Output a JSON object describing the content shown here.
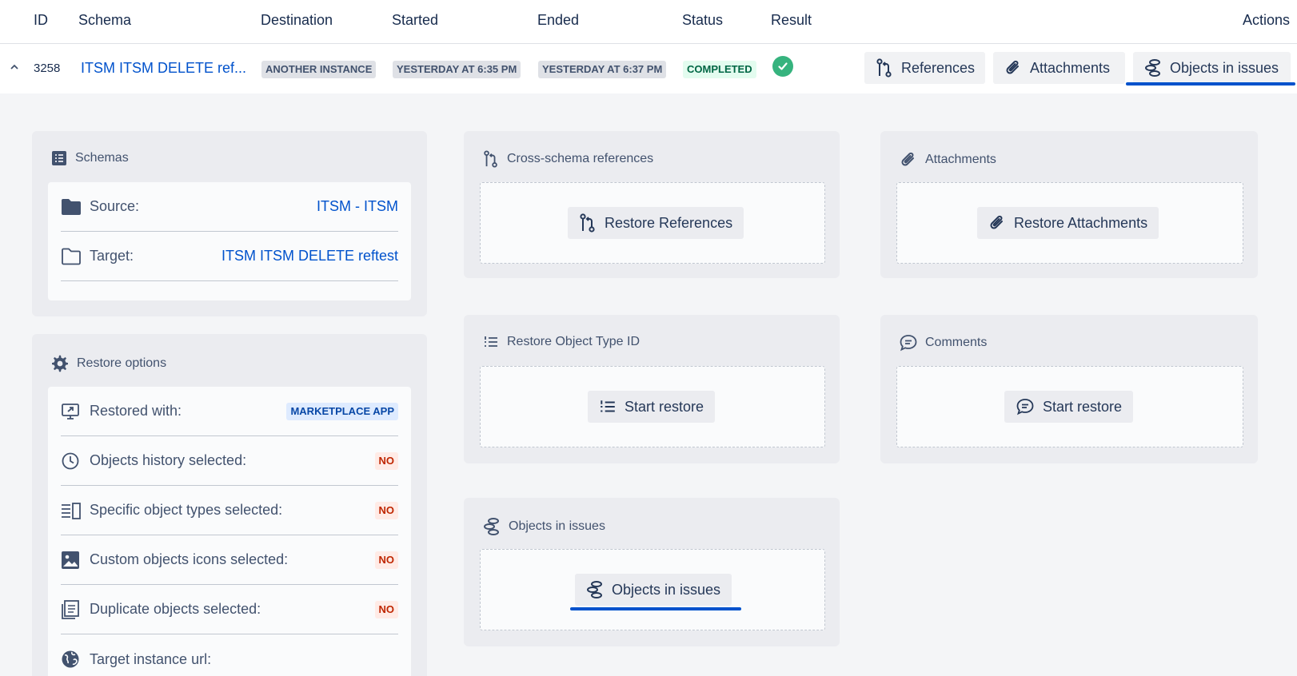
{
  "table": {
    "headers": {
      "id": "ID",
      "schema": "Schema",
      "destination": "Destination",
      "started": "Started",
      "ended": "Ended",
      "status": "Status",
      "result": "Result",
      "actions": "Actions"
    },
    "row": {
      "id": "3258",
      "schema": "ITSM ITSM DELETE ref...",
      "destination": "ANOTHER INSTANCE",
      "started": "YESTERDAY AT 6:35 PM",
      "ended": "YESTERDAY AT 6:37 PM",
      "status": "COMPLETED",
      "result_icon": "check-circle-icon",
      "actions": [
        {
          "label": "References",
          "icon": "git-branch-icon"
        },
        {
          "label": "Attachments",
          "icon": "paperclip-icon"
        },
        {
          "label": "Objects in issues",
          "icon": "object-stack-icon",
          "selected": true
        }
      ]
    }
  },
  "schemas": {
    "title": "Schemas",
    "source_label": "Source:",
    "source_value": "ITSM - ITSM",
    "target_label": "Target:",
    "target_value": "ITSM ITSM DELETE reftest"
  },
  "restore_options": {
    "title": "Restore options",
    "rows": [
      {
        "label": "Restored with:",
        "value": "MARKETPLACE APP"
      },
      {
        "label": "Objects history selected:",
        "value": "NO"
      },
      {
        "label": "Specific object types selected:",
        "value": "NO"
      },
      {
        "label": "Custom objects icons selected:",
        "value": "NO"
      },
      {
        "label": "Duplicate objects selected:",
        "value": "NO"
      },
      {
        "label": "Target instance url:",
        "value": ""
      }
    ]
  },
  "cross_schema": {
    "title": "Cross-schema references",
    "button": "Restore References"
  },
  "attachments": {
    "title": "Attachments",
    "button": "Restore Attachments"
  },
  "object_type_id": {
    "title": "Restore Object Type ID",
    "button": "Start restore"
  },
  "comments": {
    "title": "Comments",
    "button": "Start restore"
  },
  "objects_in_issues": {
    "title": "Objects in issues",
    "button": "Objects in issues"
  },
  "colors": {
    "link": "#0052CC",
    "success": "#36B37E",
    "danger_text": "#BF2600",
    "panel_bg": "#EBECF0"
  }
}
